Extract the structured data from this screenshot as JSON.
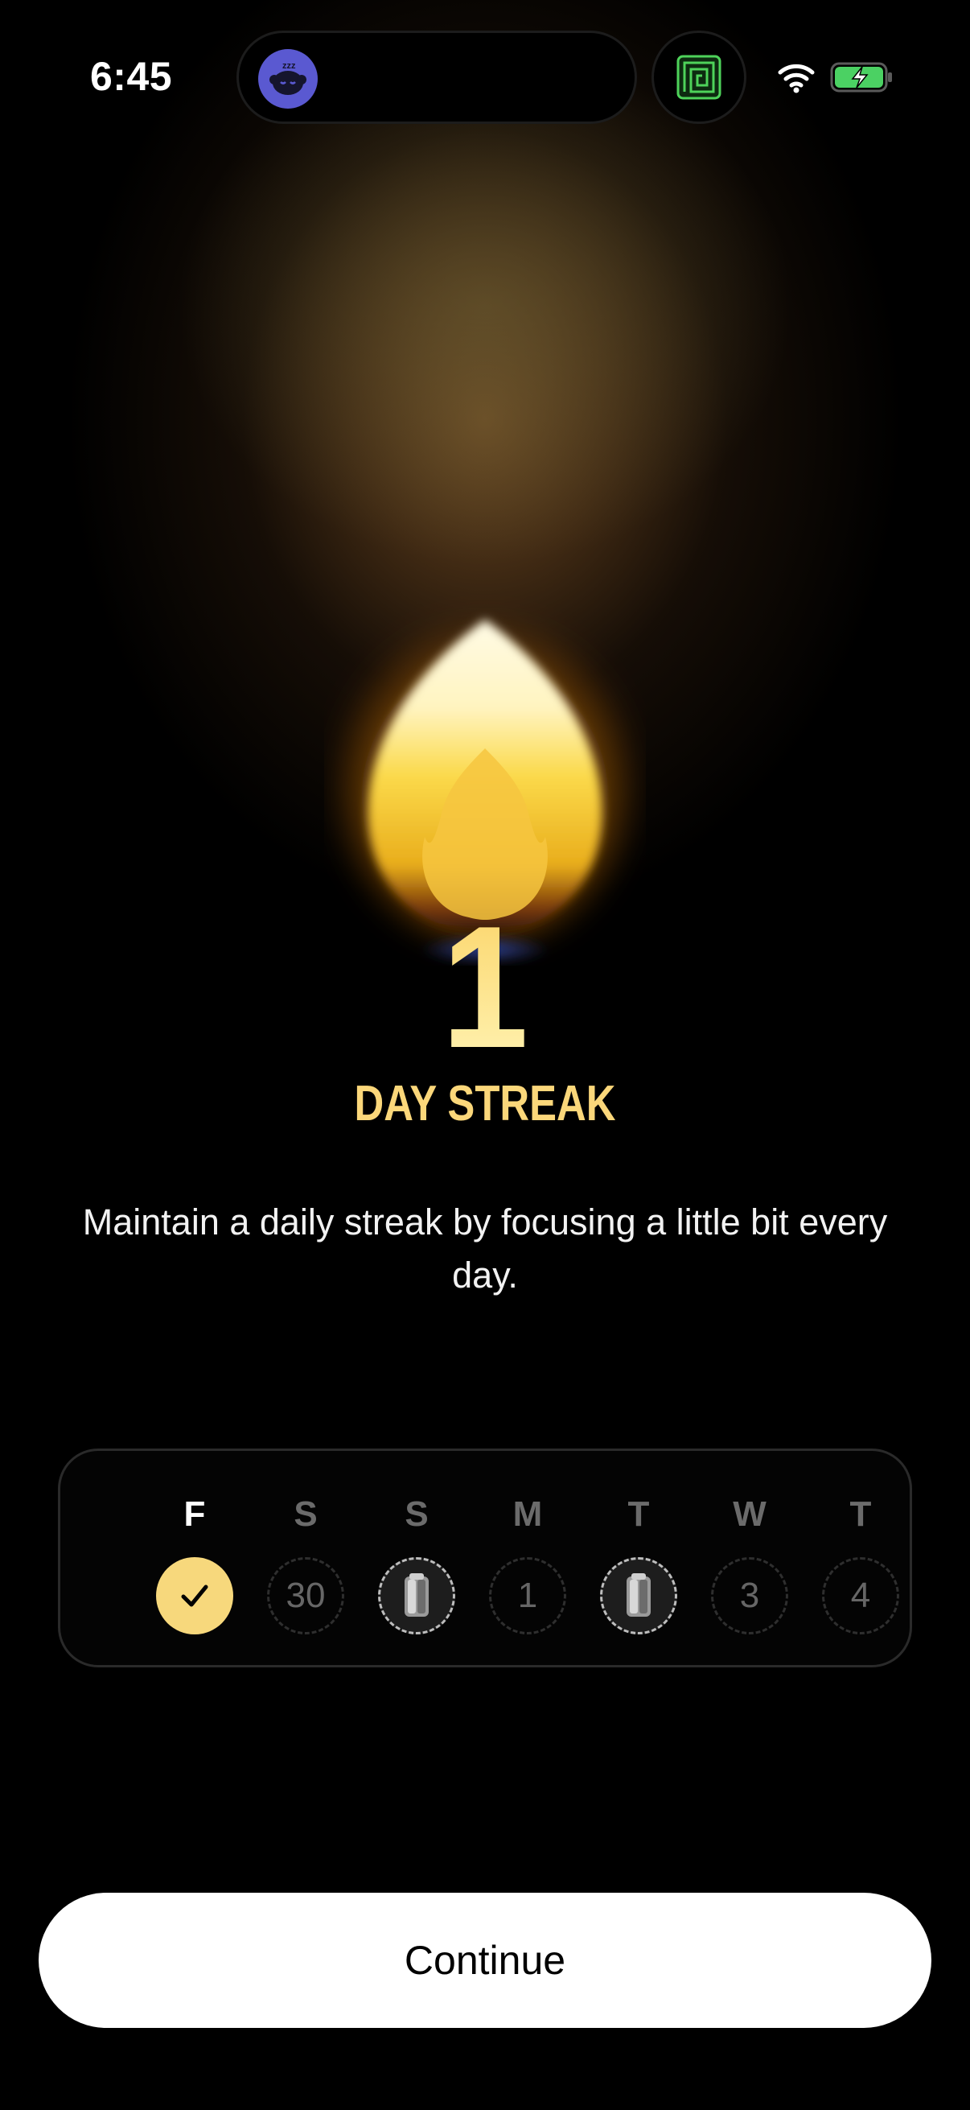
{
  "status_bar": {
    "time": "6:45",
    "left_app_icon": "sleeping-monster-icon",
    "right_app_icon": "maze-icon",
    "wifi_icon": "wifi-icon",
    "battery_icon": "battery-charging-icon"
  },
  "streak": {
    "count": "1",
    "label": "DAY STREAK",
    "icon": "flame-icon"
  },
  "subtitle": "Maintain a daily streak by focusing a little bit every day.",
  "week": {
    "days": [
      {
        "letter": "F",
        "value": "",
        "state": "checked"
      },
      {
        "letter": "S",
        "value": "30",
        "state": "empty"
      },
      {
        "letter": "S",
        "value": "",
        "state": "freeze"
      },
      {
        "letter": "M",
        "value": "1",
        "state": "empty"
      },
      {
        "letter": "T",
        "value": "",
        "state": "freeze"
      },
      {
        "letter": "W",
        "value": "3",
        "state": "empty"
      },
      {
        "letter": "T",
        "value": "4",
        "state": "empty"
      }
    ]
  },
  "continue_label": "Continue",
  "colors": {
    "accent": "#f7d87c",
    "streak_text": "#fbd77a",
    "background": "#000000",
    "button": "#ffffff"
  }
}
